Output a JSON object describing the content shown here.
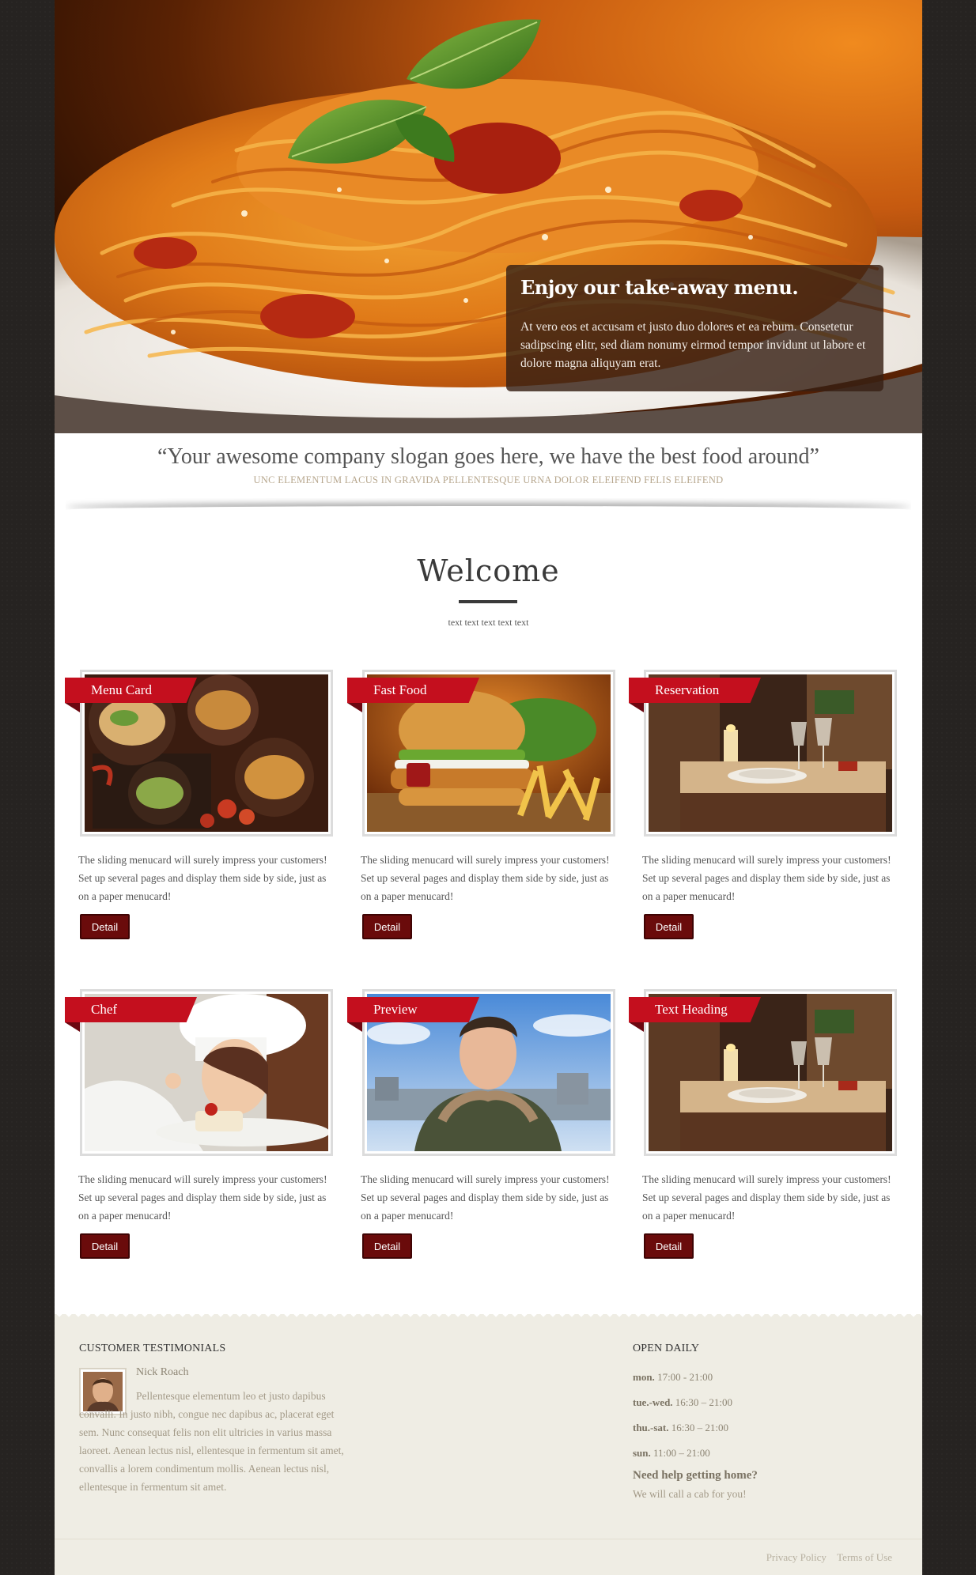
{
  "hero": {
    "caption_title": "Enjoy our take-away menu.",
    "caption_text": "At vero eos et accusam et justo duo dolores et ea rebum. Consetetur sadipscing elitr, sed diam nonumy eirmod tempor invidunt ut labore et dolore magna aliquyam erat."
  },
  "slogan": {
    "quote": "“Your awesome company slogan goes here, we have the best food around”",
    "sub": "UNC ELEMENTUM LACUS IN GRAVIDA PELLENTESQUE URNA DOLOR ELEIFEND FELIS ELEIFEND"
  },
  "welcome": {
    "title": "Welcome",
    "subtitle": "text text text text text"
  },
  "cards": [
    {
      "title": "Menu Card",
      "image": "food-platter",
      "desc": "The sliding menucard will surely impress your customers! Set up several pages and display them side by side, just as on a paper menucard!",
      "button": "Detail"
    },
    {
      "title": "Fast Food",
      "image": "burger-fries",
      "desc": "The sliding menucard will surely impress your customers! Set up several pages and display them side by side, just as on a paper menucard!",
      "button": "Detail"
    },
    {
      "title": "Reservation",
      "image": "restaurant-table",
      "desc": "The sliding menucard will surely impress your customers! Set up several pages and display them side by side, just as on a paper menucard!",
      "button": "Detail"
    },
    {
      "title": "Chef",
      "image": "chef-plating",
      "desc": "The sliding menucard will surely impress your customers! Set up several pages and display them side by side, just as on a paper menucard!",
      "button": "Detail"
    },
    {
      "title": "Preview",
      "image": "man-portrait",
      "desc": "The sliding menucard will surely impress your customers! Set up several pages and display them side by side, just as on a paper menucard!",
      "button": "Detail"
    },
    {
      "title": "Text Heading",
      "image": "restaurant-table",
      "desc": "The sliding menucard will surely impress your customers! Set up several pages and display them side by side, just as on a paper menucard!",
      "button": "Detail"
    }
  ],
  "footer": {
    "testimonials_heading": "CUSTOMER TESTIMONIALS",
    "testimonial_name": "Nick Roach",
    "testimonial_text": "Pellentesque elementum leo et justo dapibus convalli. In justo nibh, congue nec dapibus ac, placerat eget sem. Nunc consequat felis non elit ultricies in varius massa laoreet. Aenean lectus nisl, ellentesque in fermentum sit amet, convallis a lorem condimentum mollis. Aenean lectus nisl, ellentesque in fermentum sit amet.",
    "hours_heading": "OPEN DAILY",
    "hours": [
      {
        "day": "mon.",
        "time": "17:00 - 21:00"
      },
      {
        "day": "tue.-wed.",
        "time": "16:30 – 21:00"
      },
      {
        "day": "thu.-sat.",
        "time": "16:30 – 21:00"
      },
      {
        "day": "sun.",
        "time": "11:00 – 21:00"
      }
    ],
    "help_title": "Need help getting home?",
    "help_text": "We will call a cab for you!",
    "links": [
      "Privacy Policy",
      "Terms of Use"
    ]
  },
  "colors": {
    "ribbon": "#c40f1e",
    "button": "#6a0b0b",
    "footer_bg": "#efede4",
    "outer_bg": "#262321"
  }
}
